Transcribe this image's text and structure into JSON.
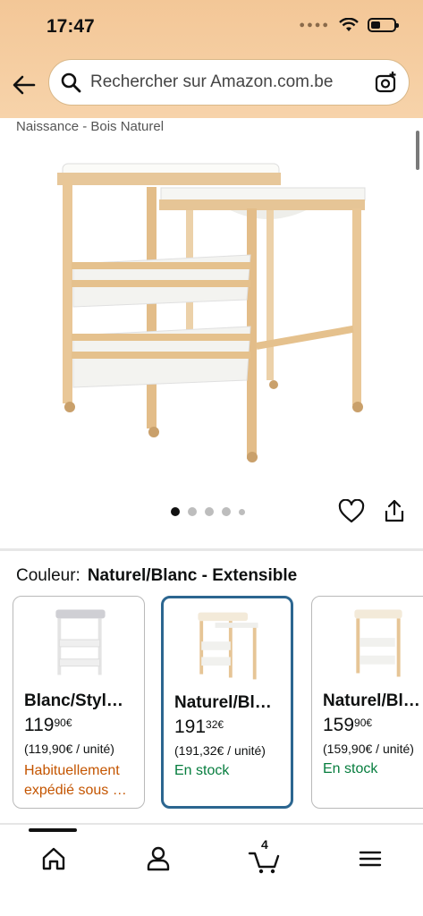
{
  "status_bar": {
    "time": "17:47"
  },
  "search": {
    "placeholder": "Rechercher sur Amazon.com.be"
  },
  "product": {
    "title_visible": "Naissance - Bois Naturel",
    "image_count": 5,
    "active_image": 1
  },
  "variation": {
    "label": "Couleur:",
    "selected": "Naturel/Blanc - Extensible"
  },
  "options": [
    {
      "name": "Blanc/Styl…",
      "price_int": "119",
      "price_dec": "90",
      "currency": "€",
      "unit": "(119,90€ / unité)",
      "availability": "Habituellement expédié sous …",
      "availability_color": "#c45500",
      "selected": false
    },
    {
      "name": "Naturel/Bl…",
      "price_int": "191",
      "price_dec": "32",
      "currency": "€",
      "unit": "(191,32€ / unité)",
      "availability": "En stock",
      "availability_color": "#067d3e",
      "selected": true
    },
    {
      "name": "Naturel/Bl…",
      "price_int": "159",
      "price_dec": "90",
      "currency": "€",
      "unit": "(159,90€ / unité)",
      "availability": "En stock",
      "availability_color": "#067d3e",
      "selected": false
    }
  ],
  "nav": {
    "cart_count": "4"
  },
  "colors": {
    "header_bg": "#f3c797",
    "selected_border": "#2c6690",
    "in_stock": "#067d3e"
  }
}
